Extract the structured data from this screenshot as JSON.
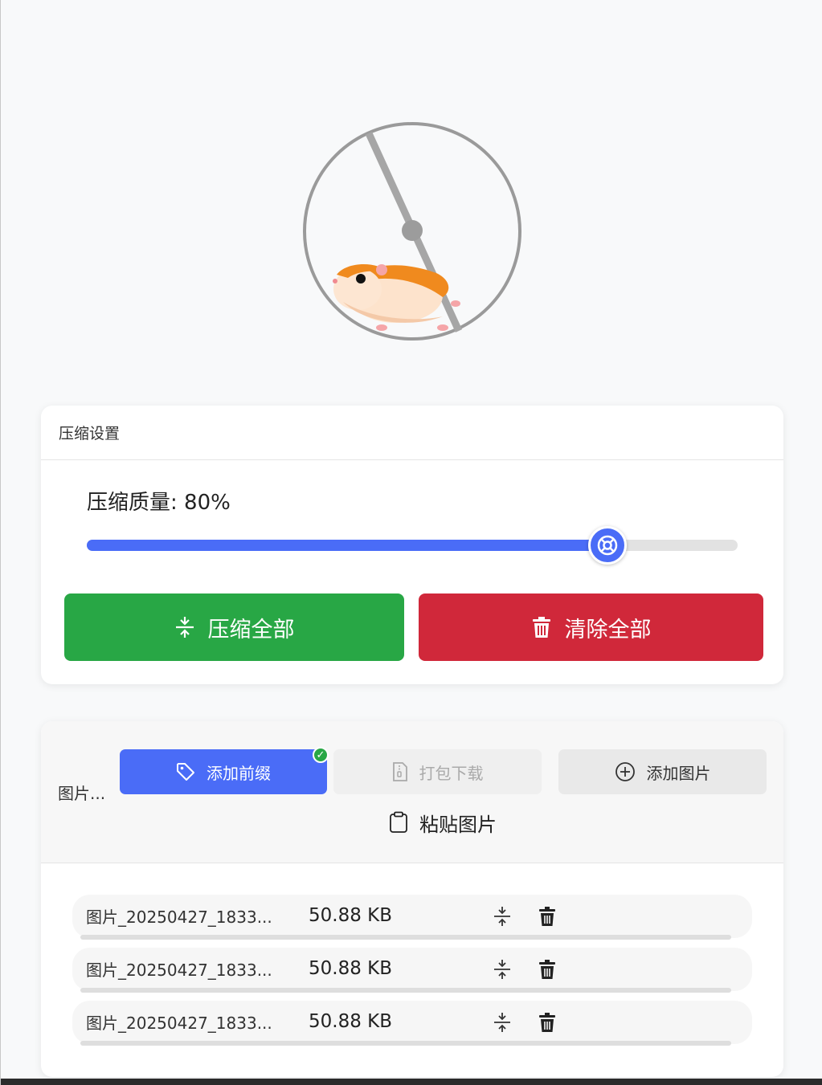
{
  "loader": {
    "icon": "hamster-wheel-loader"
  },
  "settings": {
    "title": "压缩设置",
    "quality_label": "压缩质量: 80%",
    "quality_percent": 80,
    "compress_all_label": "压缩全部",
    "clear_all_label": "清除全部"
  },
  "files_panel": {
    "title": "图片...",
    "add_prefix_label": "添加前缀",
    "zip_download_label": "打包下载",
    "add_image_label": "添加图片",
    "paste_image_label": "粘贴图片",
    "prefix_enabled_mark": "✓"
  },
  "files": [
    {
      "name": "图片_20250427_1833...",
      "size": "50.88 KB"
    },
    {
      "name": "图片_20250427_1833...",
      "size": "50.88 KB"
    },
    {
      "name": "图片_20250427_1833...",
      "size": "50.88 KB"
    }
  ],
  "colors": {
    "accent": "#4a6cf7",
    "success": "#28a745",
    "danger": "#d0283a"
  }
}
